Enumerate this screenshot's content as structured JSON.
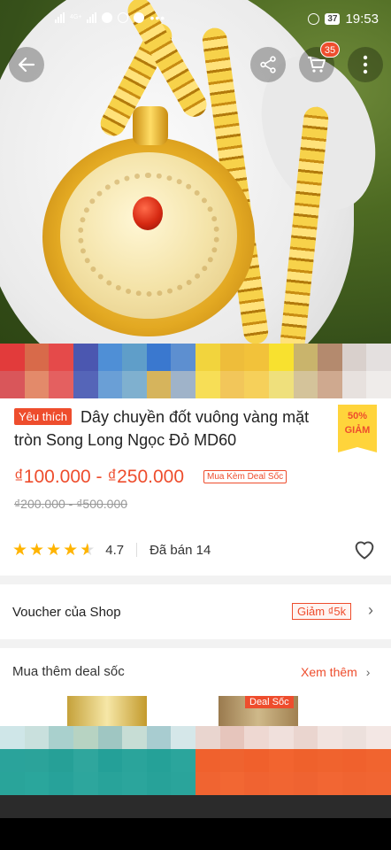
{
  "status_bar": {
    "network": "4G+",
    "battery": "37",
    "time": "19:53"
  },
  "cart": {
    "badge_count": "35"
  },
  "product": {
    "favorite_tag": "Yêu thích",
    "title": "Dây chuyền đốt vuông vàng mặt tròn Song Long Ngọc Đỏ MD60",
    "discount_percent": "50%",
    "discount_label": "GIẢM",
    "price_range": "₫100.000 - ₫250.000",
    "deal_chip": "Mua Kèm Deal Sốc",
    "original_price_range": "₫200.000 - ₫500.000",
    "rating": 4.7,
    "rating_text": "4.7",
    "sold_text": "Đã bán 14"
  },
  "voucher": {
    "label": "Voucher của Shop",
    "chip": "Giảm ₫5k"
  },
  "deals": {
    "title": "Mua thêm deal sốc",
    "see_more": "Xem thêm",
    "item_tag": "Deal Sốc"
  },
  "colors": {
    "accent": "#ee4d2d",
    "star": "#ffb400",
    "discount_bg": "#ffd43b"
  },
  "icons": [
    "back-arrow-icon",
    "share-icon",
    "cart-icon",
    "more-vertical-icon",
    "heart-icon",
    "chevron-right-icon",
    "star-icon"
  ]
}
